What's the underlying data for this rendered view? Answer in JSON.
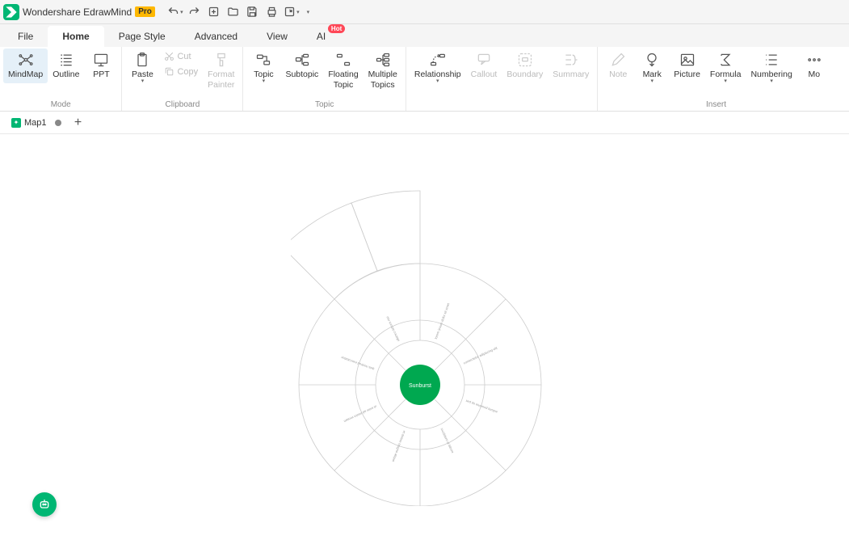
{
  "app": {
    "title": "Wondershare EdrawMind",
    "badge": "Pro"
  },
  "menu": {
    "tabs": [
      "File",
      "Home",
      "Page Style",
      "Advanced",
      "View",
      "AI"
    ],
    "active": "Home",
    "hot_badge": "Hot"
  },
  "ribbon": {
    "groups": {
      "mode": {
        "label": "Mode",
        "mindmap": "MindMap",
        "outline": "Outline",
        "ppt": "PPT"
      },
      "clipboard": {
        "label": "Clipboard",
        "paste": "Paste",
        "cut": "Cut",
        "copy": "Copy",
        "format_painter": "Format\nPainter"
      },
      "topic": {
        "label": "Topic",
        "topic": "Topic",
        "subtopic": "Subtopic",
        "floating": "Floating\nTopic",
        "multiple": "Multiple\nTopics"
      },
      "relation": {
        "relationship": "Relationship",
        "callout": "Callout",
        "boundary": "Boundary",
        "summary": "Summary"
      },
      "insert": {
        "label": "Insert",
        "note": "Note",
        "mark": "Mark",
        "picture": "Picture",
        "formula": "Formula",
        "numbering": "Numbering",
        "more": "Mo"
      }
    }
  },
  "doc_tabs": {
    "map1": "Map1"
  },
  "sunburst": {
    "center": "Sunburst"
  }
}
